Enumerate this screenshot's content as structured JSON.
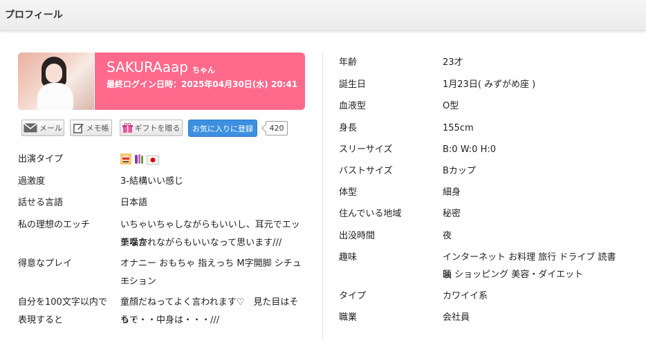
{
  "header": {
    "title": "プロフィール"
  },
  "profile": {
    "name": "SAKURAaap",
    "suffix": "ちゃん",
    "last_login": "最終ログイン日時：2025年04月30日(水) 20:41"
  },
  "actions": {
    "mail": "メール",
    "memo": "メモ帳",
    "gift": "ギフトを贈る",
    "favorite": "お気に入りに登録",
    "favorite_count": "420"
  },
  "left_rows": [
    {
      "label": "出演タイプ",
      "value": ""
    },
    {
      "label": "過激度",
      "value": "3-結構いい感じ"
    },
    {
      "label": "話せる言語",
      "value": "日本語"
    },
    {
      "label": "私の理想のエッチ",
      "value_lines": [
        "いちゃいちゃしながらもいいし、耳元でエッチな言",
        "葉囁かれながらもいいなって思います///"
      ]
    },
    {
      "label": "得意なプレイ",
      "value_lines": [
        "オナニー おもちゃ 指えっち M字開脚 シチュエ",
        "ーション"
      ]
    },
    {
      "label_lines": [
        "自分を100文字以内で",
        "表現すると"
      ],
      "value_lines": [
        "童顔だねってよく言われます♡　見た目はそうで",
        "も・・・中身は・・・///"
      ]
    }
  ],
  "right_rows": [
    {
      "label": "年齢",
      "value": "23才"
    },
    {
      "label": "誕生日",
      "value": "1月23日( みずがめ座 )"
    },
    {
      "label": "血液型",
      "value": "O型"
    },
    {
      "label": "身長",
      "value": "155cm"
    },
    {
      "label": "スリーサイズ",
      "value": "B:0 W:0 H:0"
    },
    {
      "label": "バストサイズ",
      "value": "Bカップ"
    },
    {
      "label": "体型",
      "value": "細身"
    },
    {
      "label": "住んでいる地域",
      "value": "秘密"
    },
    {
      "label": "出没時間",
      "value": "夜"
    },
    {
      "label": "趣味",
      "value_lines": [
        "インターネット お料理 旅行 ドライブ 読書 映",
        "画 ショッピング 美容・ダイエット"
      ]
    },
    {
      "label": "タイプ",
      "value": "カワイイ系"
    },
    {
      "label": "職業",
      "value": "会社員"
    }
  ],
  "icons": {
    "type_icons": [
      "face-mask-icon",
      "toy-icon",
      "japan-flag-icon"
    ],
    "accent": "#ff6a8c",
    "favorite_color": "#3d8fe0"
  }
}
